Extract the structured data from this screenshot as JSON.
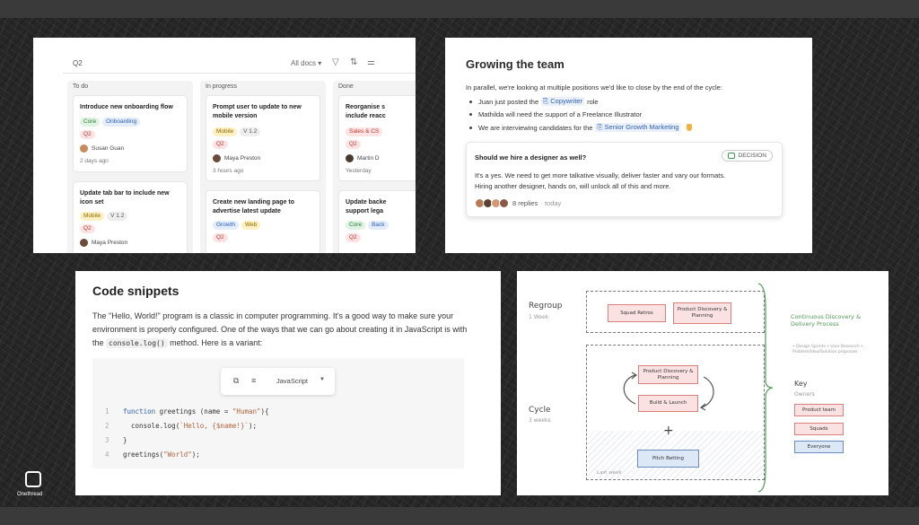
{
  "kanban": {
    "quarter": "Q2",
    "all_docs": "All docs ▾",
    "columns": [
      {
        "title": "To do"
      },
      {
        "title": "In progress"
      },
      {
        "title": "Done"
      }
    ],
    "cards": {
      "todo1": {
        "title": "Introduce new onboarding flow",
        "tags": [
          "Core",
          "Onboarding",
          "Q2"
        ],
        "person": "Susan Guan",
        "time": "2 days ago"
      },
      "todo2": {
        "title": "Update tab bar to include new icon set",
        "tags": [
          "Mobile",
          "V 1.2",
          "Q2"
        ],
        "person": "Maya Preston"
      },
      "prog1": {
        "title": "Prompt user to update to new mobile version",
        "tags": [
          "Mobile",
          "V 1.2",
          "Q2"
        ],
        "person": "Maya Preston",
        "time": "3 hours ago"
      },
      "prog2": {
        "title": "Create new landing page to advertise latest update",
        "tags": [
          "Growth",
          "Web",
          "Q2"
        ]
      },
      "done1": {
        "title": "Reorganise s include reacc",
        "tags": [
          "Sales & CS",
          "Q2"
        ],
        "person": "Martin D",
        "time": "Yesterday"
      },
      "done2": {
        "title": "Update backe support lega",
        "tags": [
          "Core",
          "Back",
          "Q2"
        ]
      }
    }
  },
  "team": {
    "title": "Growing the team",
    "intro": "In parallel, we're looking at multiple positions we'd like to close by the end of the cycle:",
    "b1_pre": "Juan just posted the",
    "b1_mention": "Copywriter",
    "b1_post": "role",
    "b2": "Mathilda will need the support of a Freelance Illustrator",
    "b3_pre": "We are interviewing candidates for the",
    "b3_mention": "Senior Growth Marketing",
    "decision": {
      "question": "Should we hire a designer as well?",
      "badge": "DECISION",
      "text": "It's a yes. We need to get more talkative visually, deliver faster and vary our formats. Hiring another designer, hands on, will unlock all of this and more.",
      "replies": "8 replies",
      "when": "· today"
    }
  },
  "code": {
    "title": "Code snippets",
    "para_1": "The \"Hello, World!\" program is a classic in computer programming. It's a good way to make sure your environment is properly configured. One of the ways that we can go about creating it in JavaScript is with the",
    "inline": "console.log()",
    "para_2": "method. Here is a variant:",
    "language": "JavaScript",
    "lines": {
      "l1": {
        "n": "1",
        "kw": "function",
        "rest": " greetings (name = ",
        "str": "\"Human\"",
        "end": "){"
      },
      "l2": {
        "n": "2",
        "a": "  console.log(",
        "str": "`Hello, {$name!}`",
        "end": ");"
      },
      "l3": {
        "n": "3",
        "text": "}"
      },
      "l4": {
        "n": "4",
        "a": "greetings(",
        "str": "\"World\"",
        "end": ");"
      }
    }
  },
  "process": {
    "regroup": "Regroup",
    "regroup_sub": "1 Week",
    "squad_retros": "Squad Retros",
    "pdp_top": "Product Discovery & Planning",
    "cycle": "Cycle",
    "cycle_sub": "3 weeks",
    "pdp_cycle": "Product Discovery & Planning",
    "build": "Build & Launch",
    "plus": "+",
    "pitch": "Pitch Betting",
    "last_week": "Last week",
    "continuous": "Continuous Discovery & Delivery Process",
    "notes": "• Design Sprints • User Research • Problem/Idea/Solution proposals",
    "key": "Key",
    "owners": "Owners",
    "k1": "Product team",
    "k2": "Squads",
    "k3": "Everyone"
  },
  "logo": {
    "name": "Onethread"
  },
  "colors": {
    "accent_blue": "#2d5fb8",
    "tag_red": "#c2392f",
    "decision_green": "#3b9b58",
    "board_bg": "#262626"
  }
}
